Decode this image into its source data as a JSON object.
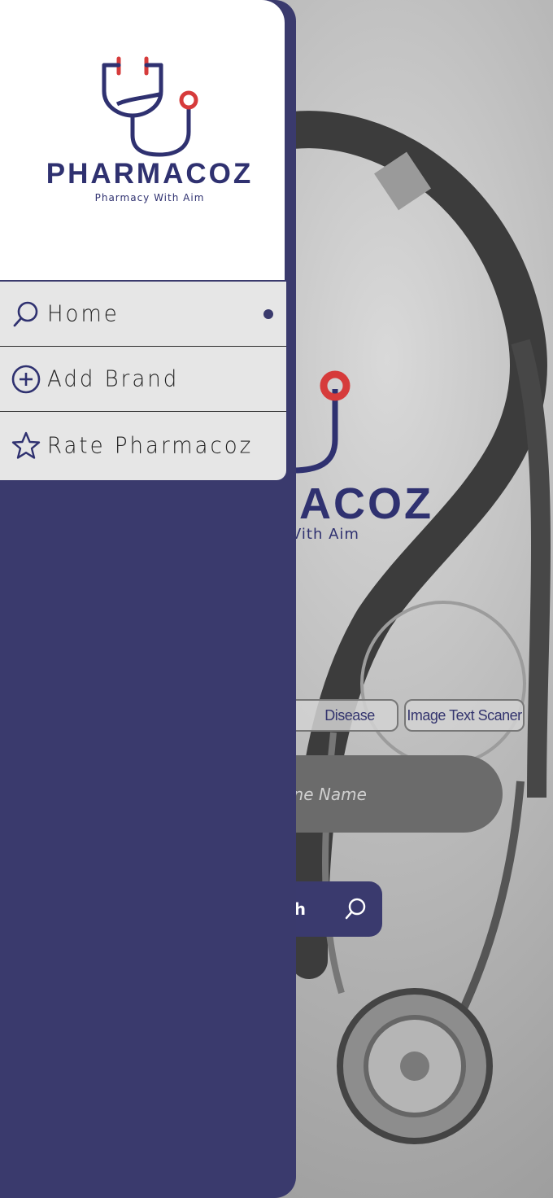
{
  "background": {
    "logo_name_partial": "ACOZ",
    "logo_tagline_partial": "Vith Aim",
    "tabs": [
      {
        "label": "Disease"
      },
      {
        "label": "Image Text Scaner"
      }
    ],
    "search_input_placeholder_partial": "cine Name",
    "search_button_label_partial": "h"
  },
  "drawer": {
    "logo": {
      "name": "PHARMACOZ",
      "tagline": "Pharmacy With Aim"
    },
    "menu": [
      {
        "label": "Home",
        "icon": "search-icon",
        "active": true
      },
      {
        "label": "Add Brand",
        "icon": "plus-circle-icon",
        "active": false
      },
      {
        "label": "Rate Pharmacoz",
        "icon": "star-icon",
        "active": false
      }
    ]
  },
  "colors": {
    "brand_navy": "#2f3170",
    "drawer_bg": "#3a3a6d",
    "accent_red": "#d63b3b",
    "menu_bg": "#e6e6e6"
  }
}
